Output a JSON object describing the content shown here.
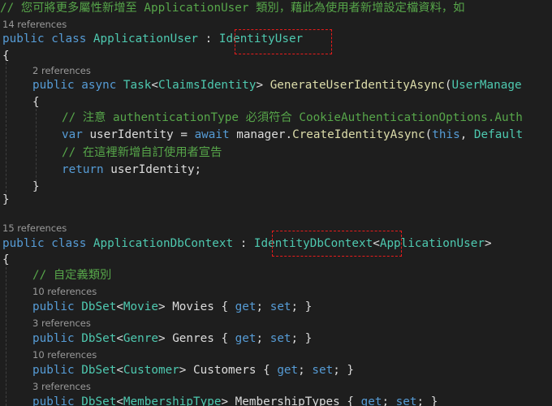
{
  "code": {
    "comment_top": "// 您可將更多屬性新增至 ApplicationUser 類別，藉此為使用者新增設定檔資料，如",
    "refs_class1": "14 references",
    "kw_public": "public",
    "kw_class": "class",
    "kw_async": "async",
    "kw_var": "var",
    "kw_await": "await",
    "kw_return": "return",
    "kw_this": "this",
    "kw_get": "get",
    "kw_set": "set",
    "class1_name": "ApplicationUser",
    "colon": ":",
    "class1_base": "IdentityUser",
    "brace_open": "{",
    "brace_close": "}",
    "refs_method": "2 references",
    "type_task": "Task",
    "lt": "<",
    "gt": ">",
    "type_claims": "ClaimsIdentity",
    "method_name": "GenerateUserIdentityAsync",
    "paren_open": "(",
    "param_type_partial": "UserManage",
    "comment_auth": "// 注意 authenticationType 必須符合 CookieAuthenticationOptions.Auth",
    "var_useridentity": "userIdentity",
    "assign": "=",
    "manager_dot": "manager.",
    "create_method": "CreateIdentityAsync",
    "comma": ",",
    "default_partial": "Default",
    "comment_claims": "// 在這裡新增自訂使用者宣告",
    "return_value": "userIdentity;",
    "refs_class2": "15 references",
    "class2_name": "ApplicationDbContext",
    "class2_base": "IdentityDbContext",
    "class2_generic": "ApplicationUser",
    "comment_custom": "// 自定義類別",
    "dbset": "DbSet",
    "accessor_open": "{",
    "accessor_sep": ";",
    "accessor_close": "; }",
    "props": [
      {
        "refs": "10 references",
        "type": "Movie",
        "name": "Movies"
      },
      {
        "refs": "3 references",
        "type": "Genre",
        "name": "Genres"
      },
      {
        "refs": "10 references",
        "type": "Customer",
        "name": "Customers"
      },
      {
        "refs": "3 references",
        "type": "MembershipType",
        "name": "MembershipTypes"
      }
    ]
  },
  "colors": {
    "background": "#1e1e1e",
    "keyword": "#569cd6",
    "type": "#4ec9b0",
    "method": "#dcdcaa",
    "comment": "#57a64a",
    "highlight_box": "#e81c1c"
  }
}
